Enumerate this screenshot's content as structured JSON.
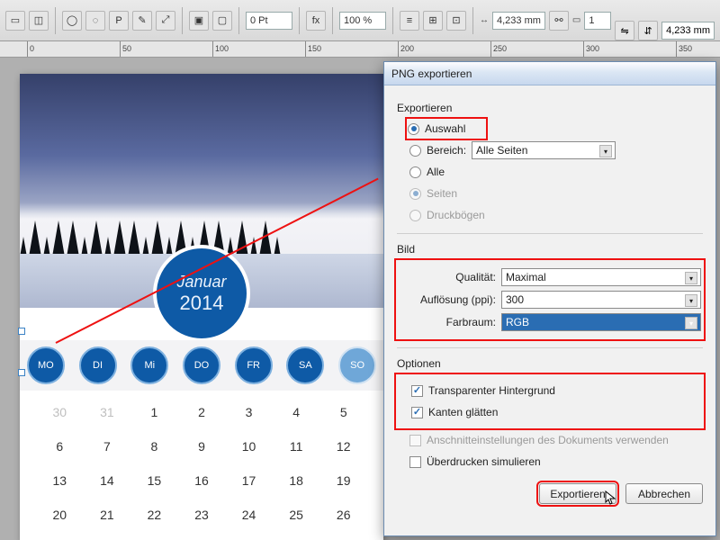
{
  "toolbar": {
    "stroke_value": "0 Pt",
    "zoom_value": "100 %",
    "dim_x": "4,233 mm",
    "dim_h": "4,233 mm",
    "dim_w": "1"
  },
  "ruler_ticks": [
    "0",
    "50",
    "100",
    "150",
    "200",
    "250",
    "300",
    "350"
  ],
  "calendar": {
    "month": "Januar",
    "year": "2014",
    "day_labels": [
      "MO",
      "DI",
      "Mi",
      "DO",
      "FR",
      "SA",
      "SO"
    ],
    "grid": [
      {
        "v": "30",
        "dim": true
      },
      {
        "v": "31",
        "dim": true
      },
      {
        "v": "1"
      },
      {
        "v": "2"
      },
      {
        "v": "3"
      },
      {
        "v": "4"
      },
      {
        "v": "5"
      },
      {
        "v": "6"
      },
      {
        "v": "7"
      },
      {
        "v": "8"
      },
      {
        "v": "9"
      },
      {
        "v": "10"
      },
      {
        "v": "11"
      },
      {
        "v": "12"
      },
      {
        "v": "13"
      },
      {
        "v": "14"
      },
      {
        "v": "15"
      },
      {
        "v": "16"
      },
      {
        "v": "17"
      },
      {
        "v": "18"
      },
      {
        "v": "19"
      },
      {
        "v": "20"
      },
      {
        "v": "21"
      },
      {
        "v": "22"
      },
      {
        "v": "23"
      },
      {
        "v": "24"
      },
      {
        "v": "25"
      },
      {
        "v": "26"
      }
    ]
  },
  "dialog": {
    "title": "PNG exportieren",
    "section_export": "Exportieren",
    "radio_auswahl": "Auswahl",
    "radio_bereich": "Bereich:",
    "bereich_value": "Alle Seiten",
    "radio_alle": "Alle",
    "radio_seiten": "Seiten",
    "radio_druck": "Druckbögen",
    "section_bild": "Bild",
    "label_qual": "Qualität:",
    "qual_value": "Maximal",
    "label_res": "Auflösung (ppi):",
    "res_value": "300",
    "label_farb": "Farbraum:",
    "farb_value": "RGB",
    "section_opt": "Optionen",
    "chk_transp": "Transparenter Hintergrund",
    "chk_kanten": "Kanten glätten",
    "chk_anschnitt": "Anschnitteinstellungen des Dokuments verwenden",
    "chk_ueber": "Überdrucken simulieren",
    "btn_export": "Exportieren",
    "btn_cancel": "Abbrechen"
  }
}
